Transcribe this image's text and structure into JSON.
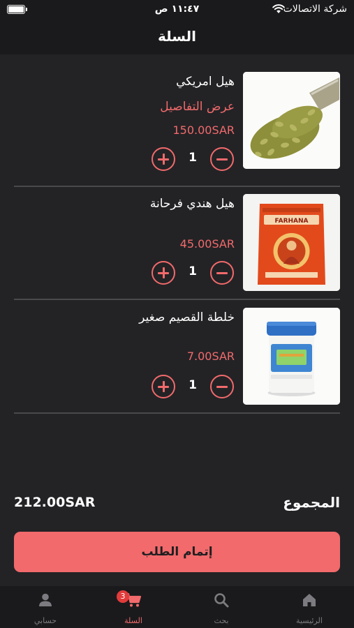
{
  "status_bar": {
    "carrier": "شركة الاتصالات",
    "time": "١١:٤٧ ص"
  },
  "header": {
    "title": "السلة"
  },
  "cart": {
    "items": [
      {
        "name": "هيل امريكي",
        "details_link": "عرض التفاصيل",
        "price": "150.00SAR",
        "quantity": "1",
        "image": "green-cardamom-scoop"
      },
      {
        "name": "هيل هندي فرحانة",
        "details_link": "",
        "price": "45.00SAR",
        "quantity": "1",
        "image": "farhana-cardamom-bag",
        "image_text": "FARHANA"
      },
      {
        "name": "خلطة القصيم صغير",
        "details_link": "",
        "price": "7.00SAR",
        "quantity": "1",
        "image": "qassim-spice-tub"
      }
    ]
  },
  "summary": {
    "total_label": "المجموع",
    "total_value": "212.00SAR"
  },
  "checkout": {
    "label": "إتمام الطلب"
  },
  "tab_bar": {
    "items": [
      {
        "label": "الرئيسية",
        "icon": "home-icon",
        "active": false
      },
      {
        "label": "بحث",
        "icon": "search-icon",
        "active": false
      },
      {
        "label": "السلة",
        "icon": "cart-icon",
        "active": true,
        "badge": "3"
      },
      {
        "label": "حسابي",
        "icon": "person-icon",
        "active": false
      }
    ]
  },
  "colors": {
    "accent": "#f26a6b",
    "background": "#232326",
    "bar_background": "#1a1a1c",
    "inactive_tab": "#7c7c80"
  }
}
